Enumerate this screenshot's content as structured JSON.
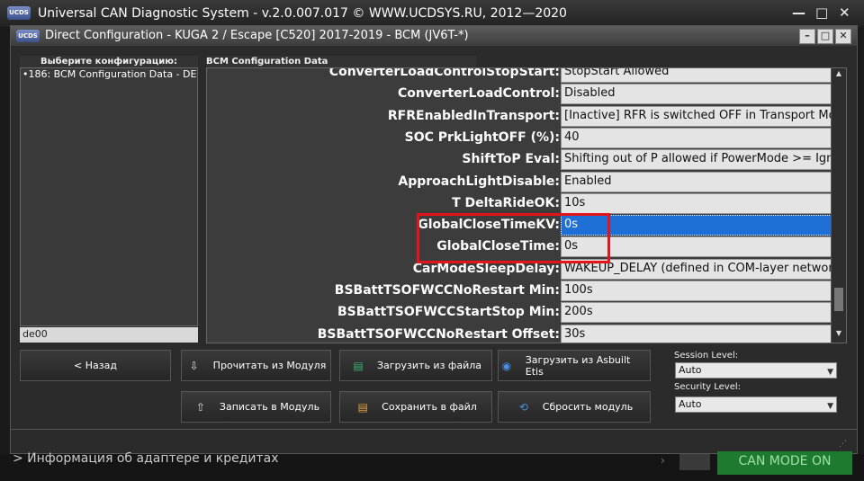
{
  "app": {
    "title": "Universal CAN Diagnostic System  -  v.2.0.007.017 © WWW.UCDSYS.RU, 2012—2020",
    "logo_text": "UCDS",
    "controls": [
      "—",
      "□",
      "✕"
    ]
  },
  "dialog": {
    "title": "Direct Configuration - KUGA 2 / Escape [C520] 2017-2019 - BCM (JV6T-*)",
    "logo_text": "UCDS",
    "controls": [
      "–",
      "□",
      "✕"
    ]
  },
  "left_panel": {
    "header": "Выберите конфигурацию:",
    "items": [
      "•186: BCM Configuration Data - DE"
    ],
    "filter_value": "de00"
  },
  "config": {
    "header": "BCM Configuration Data",
    "rows": [
      {
        "label": "ConverterLoadControlStopStart:",
        "value": "StopStart Allowed"
      },
      {
        "label": "ConverterLoadControl:",
        "value": "Disabled"
      },
      {
        "label": "RFREnabledInTransport:",
        "value": "[Inactive] RFR is switched OFF in Transport Mode"
      },
      {
        "label": "SOC PrkLightOFF (%):",
        "value": "40"
      },
      {
        "label": "ShiftToP Eval:",
        "value": "Shifting out of P allowed if PowerMode >= Ignition"
      },
      {
        "label": "ApproachLightDisable:",
        "value": "Enabled"
      },
      {
        "label": "T DeltaRideOK:",
        "value": "10s"
      },
      {
        "label": "GlobalCloseTimeKV:",
        "value": "0s"
      },
      {
        "label": "GlobalCloseTime:",
        "value": "0s"
      },
      {
        "label": "CarModeSleepDelay:",
        "value": "WAKEUP_DELAY (defined in COM-layer network)"
      },
      {
        "label": "BSBattTSOFWCCNoRestart Min:",
        "value": "100s"
      },
      {
        "label": "BSBattTSOFWCCStartStop Min:",
        "value": "200s"
      },
      {
        "label": "BSBattTSOFWCCNoRestart Offset:",
        "value": "30s"
      }
    ],
    "selected_index": 7,
    "highlight_color": "#e5141c"
  },
  "buttons": {
    "back": "< Назад",
    "read_module": "Прочитать из Модуля",
    "write_module": "Записать в Модуль",
    "load_file": "Загрузить из файла",
    "save_file": "Сохранить в файл",
    "load_asbuilt": "Загрузить из Asbuilt Etis",
    "reset_module": "Сбросить модуль"
  },
  "session": {
    "session_label": "Session Level:",
    "session_value": "Auto",
    "security_label": "Security Level:",
    "security_value": "Auto"
  },
  "bottom": {
    "info_text": "> Информация об адаптере и кредитах",
    "can_mode": "CAN MODE ON",
    "can_color": "#1e7a2e"
  }
}
